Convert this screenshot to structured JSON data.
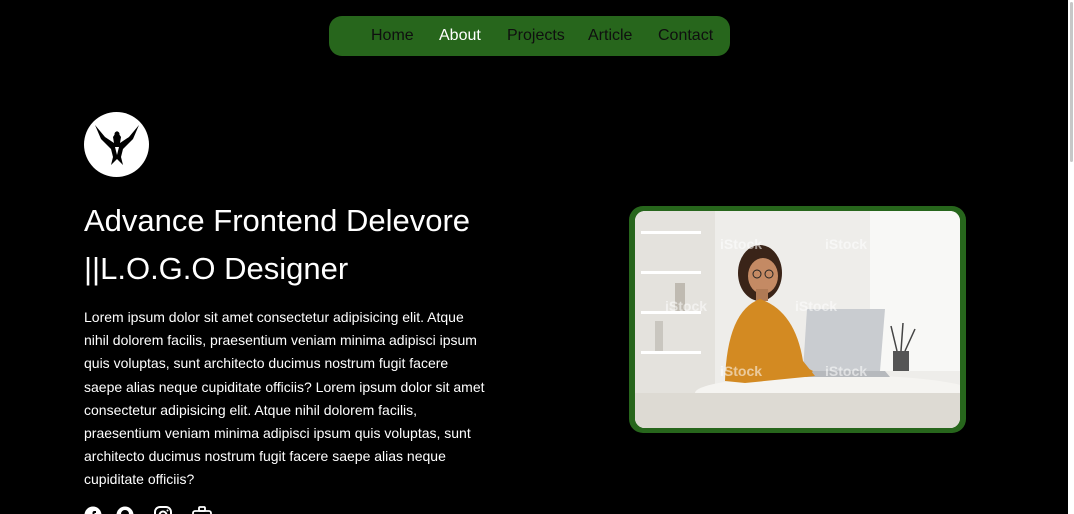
{
  "nav": {
    "items": [
      {
        "label": "Home",
        "active": false
      },
      {
        "label": "About",
        "active": true
      },
      {
        "label": "Projects",
        "active": false
      },
      {
        "label": "Article",
        "active": false
      },
      {
        "label": "Contact",
        "active": false
      }
    ],
    "background": "#27661c"
  },
  "hero": {
    "title_line1": "Advance Frontend Delevore",
    "title_line2": "||L.O.G.O Designer",
    "description": "Lorem ipsum dolor sit amet consectetur adipisicing elit. Atque nihil dolorem facilis, praesentium veniam minima adipisci ipsum quis voluptas, sunt architecto ducimus nostrum fugit facere saepe alias neque cupiditate officiis? Lorem ipsum dolor sit amet consectetur adipisicing elit. Atque nihil dolorem facilis, praesentium veniam minima adipisci ipsum quis voluptas, sunt architecto ducimus nostrum fugit facere saepe alias neque cupiditate officiis?",
    "image_alt": "woman working on laptop",
    "watermark": "iStock"
  },
  "logo": {
    "icon": "eagle-logo-icon"
  },
  "socials": [
    {
      "icon": "facebook-icon"
    },
    {
      "icon": "github-icon"
    },
    {
      "icon": "instagram-icon"
    },
    {
      "icon": "briefcase-icon"
    }
  ],
  "colors": {
    "background": "#000000",
    "accent": "#27661c",
    "text": "#ffffff"
  }
}
